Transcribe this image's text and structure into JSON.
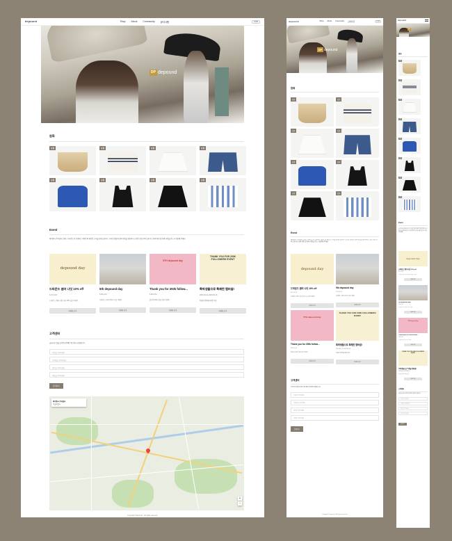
{
  "brand": {
    "logo": "depound",
    "badge": "DP"
  },
  "nav": {
    "items": [
      "Shop",
      "About",
      "Community",
      "공지사항"
    ],
    "lang": "KOR"
  },
  "colors": {
    "background": "#8c8374",
    "accent": "#857b6f",
    "logo_badge": "#c49a3a"
  },
  "products": {
    "title": "원화",
    "tag": "상품",
    "items": [
      {
        "icon": "tote-bag-icon"
      },
      {
        "icon": "striped-tee-icon"
      },
      {
        "icon": "white-skirt-icon"
      },
      {
        "icon": "denim-shorts-icon"
      },
      {
        "icon": "blue-knit-icon"
      },
      {
        "icon": "black-cami-icon"
      },
      {
        "icon": "black-skirt-icon"
      },
      {
        "icon": "striped-bag-icon"
      }
    ]
  },
  "event": {
    "title": "Event",
    "intro": "에이엔시 주식회사 브랜드 디파운드가 진행하는 이벤트와 새로운 소식을 안내드립니다. 공지된 일정과 참여 방법을 확인하시고 많은 관심 부탁드립니다. 참여 방법 및 유의 사항을 반드시 확인해 주세요.",
    "cards": [
      {
        "image": "depound day",
        "title": "드파운드 썸머 나잇 10% off",
        "date": "6.27~6.29",
        "desc": "드파운드 썸머 나잇 기념 10% 할인 이벤트",
        "button": "자세히 보기"
      },
      {
        "image": "",
        "title": "5th depound day",
        "date": "5.28~6.01",
        "desc": "디파운드 데이 5주년 기념 이벤트",
        "button": "자세히 보기"
      },
      {
        "image": "5TH depound day",
        "title": "Thank you for 200k follow...",
        "date": "5.28~5.31",
        "desc": "팔로워 20만 달성 감사 이벤트",
        "button": "자세히 보기"
      },
      {
        "image": "THANK YOU FOR 200K FOLLOWERS EVENT",
        "title": "특박생들으로 특혜한 멤버쉽!",
        "date": "2023.04.12~2023.04.16",
        "desc": "특별한 멤버쉽 혜택 안내",
        "button": "자세히 보기"
      }
    ]
  },
  "support": {
    "title": "고객센터",
    "desc": "궁금하신 점을 남겨주시면 빠르게 답변드리겠습니다.",
    "fields": [
      "이름을 입력하세요",
      "이메일을 입력하세요",
      "제목을 입력하세요",
      "내용을 입력하세요"
    ],
    "submit": "문의하기"
  },
  "map": {
    "place": "에이엔시 주식회사",
    "address": "서울특별시",
    "zoom_in": "+",
    "zoom_out": "−"
  },
  "footer": "Copyright ©depound - All rights reserved."
}
